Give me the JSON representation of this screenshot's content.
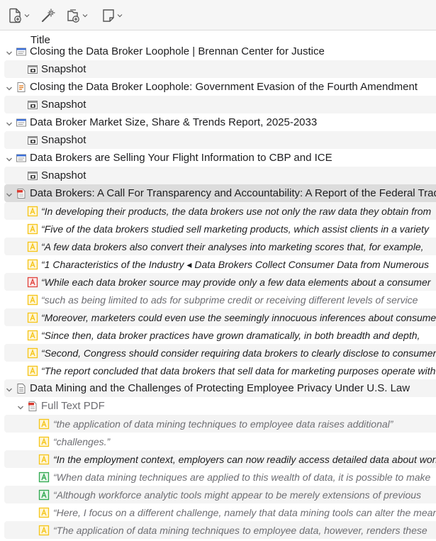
{
  "columns": {
    "title": "Title"
  },
  "colors": {
    "annotation_yellow": "#f5c518",
    "annotation_red": "#e0443e",
    "annotation_green": "#2fa84f",
    "pdf_red": "#d93a2f",
    "webpage_blue": "#3b6fd8",
    "selection": "#dcdcdc"
  },
  "rows": [
    {
      "level": 0,
      "type": "webpage",
      "title": "Closing the Data Broker Loophole | Brennan Center for Justice",
      "expanded": true
    },
    {
      "level": 1,
      "type": "snapshot",
      "title": "Snapshot"
    },
    {
      "level": 0,
      "type": "report",
      "title": "Closing the Data Broker Loophole: Government Evasion of the Fourth Amendment",
      "expanded": true
    },
    {
      "level": 1,
      "type": "snapshot",
      "title": "Snapshot"
    },
    {
      "level": 0,
      "type": "webpage",
      "title": "Data Broker Market Size, Share & Trends Report, 2025-2033",
      "expanded": true
    },
    {
      "level": 1,
      "type": "snapshot",
      "title": "Snapshot"
    },
    {
      "level": 0,
      "type": "webpage",
      "title": "Data Brokers are Selling Your Flight Information to CBP and ICE",
      "expanded": true
    },
    {
      "level": 1,
      "type": "snapshot",
      "title": "Snapshot"
    },
    {
      "level": 0,
      "type": "pdf",
      "title": "Data Brokers: A Call For Transparency and Accountability: A Report of the Federal Trade Commission",
      "expanded": true,
      "selected": true
    },
    {
      "level": 1,
      "type": "anno",
      "color": "yellow",
      "title": "“In developing their products, the data brokers use not only the raw data they obtain from"
    },
    {
      "level": 1,
      "type": "anno",
      "color": "yellow",
      "title": "“Five of the data brokers studied sell marketing products, which assist clients in a variety"
    },
    {
      "level": 1,
      "type": "anno",
      "color": "yellow",
      "title": "“A few data brokers also convert their analyses into marketing scores that, for example,"
    },
    {
      "level": 1,
      "type": "anno",
      "color": "yellow",
      "title": "“1 Characteristics of the Industry ◂ Data Brokers Collect Consumer Data from Numerous"
    },
    {
      "level": 1,
      "type": "anno",
      "color": "red",
      "title": "“While each data broker source may provide only a few data elements about a consumer"
    },
    {
      "level": 1,
      "type": "anno",
      "color": "yellow",
      "light": true,
      "title": "“such as being limited to ads for subprime credit or receiving different levels of service"
    },
    {
      "level": 1,
      "type": "anno",
      "color": "yellow",
      "title": "“Moreover, marketers could even use the seemingly innocuous inferences about consumers"
    },
    {
      "level": 1,
      "type": "anno",
      "color": "yellow",
      "title": "“Since then, data broker practices have grown dramatically, in both breadth and depth,"
    },
    {
      "level": 1,
      "type": "anno",
      "color": "yellow",
      "title": "“Second, Congress should consider requiring data brokers to clearly disclose to consumers"
    },
    {
      "level": 1,
      "type": "anno",
      "color": "yellow",
      "title": "“The report concluded that data brokers that sell data for marketing purposes operate with"
    },
    {
      "level": 0,
      "type": "document",
      "title": "Data Mining and the Challenges of Protecting Employee Privacy Under U.S. Law",
      "expanded": true
    },
    {
      "level": 1,
      "type": "pdf",
      "title": "Full Text PDF",
      "expanded": true,
      "muted": true
    },
    {
      "level": 2,
      "type": "anno",
      "color": "yellow",
      "light": true,
      "title": "“the application of data mining techniques to employee data raises additional”"
    },
    {
      "level": 2,
      "type": "anno",
      "color": "yellow",
      "light": true,
      "title": "“challenges.”"
    },
    {
      "level": 2,
      "type": "anno",
      "color": "yellow",
      "title": "“In the employment context, employers can now readily access detailed data about workers"
    },
    {
      "level": 2,
      "type": "anno",
      "color": "green",
      "light": true,
      "title": "“When data mining techniques are applied to this wealth of data, it is possible to make"
    },
    {
      "level": 2,
      "type": "anno",
      "color": "green",
      "light": true,
      "title": "“Although workforce analytic tools might appear to be merely extensions of previous"
    },
    {
      "level": 2,
      "type": "anno",
      "color": "yellow",
      "light": true,
      "title": "“Here, I focus on a different challenge, namely that data mining tools can alter the meaning"
    },
    {
      "level": 2,
      "type": "anno",
      "color": "yellow",
      "light": true,
      "title": "“The application of data mining techniques to employee data, however, renders these"
    }
  ]
}
